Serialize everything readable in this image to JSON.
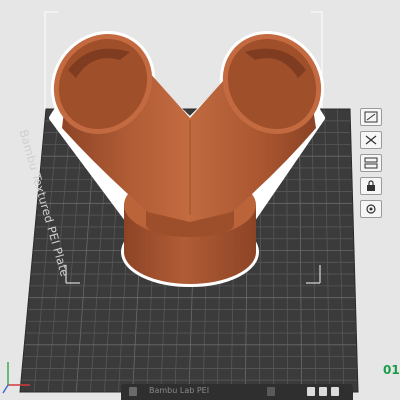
{
  "plate": {
    "label": "Bambu Textured PEI Plate"
  },
  "bottom_bar": {
    "label": "Bambu Lab PEI"
  },
  "corner_indicator": {
    "text": "01"
  },
  "toolbar": {
    "items": [
      "arrange-icon",
      "auto-orient-icon",
      "layers-icon",
      "lock-icon",
      "settings-icon"
    ]
  },
  "colors": {
    "background": "#e6e6e6",
    "plate": "#3b3b3b",
    "grid": "#575757",
    "model": "#b4603b",
    "selection_outline": "#ffffff",
    "accent": "#1c9c4a"
  }
}
